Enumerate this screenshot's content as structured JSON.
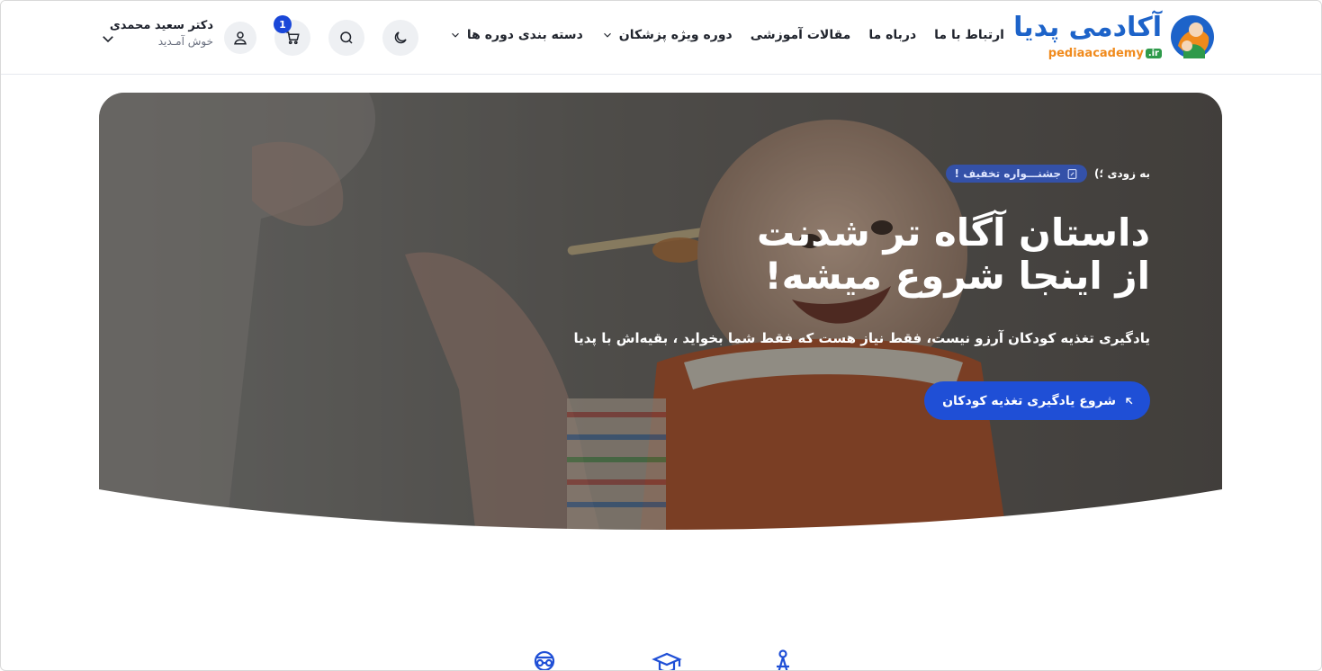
{
  "brand": {
    "name_fa": "آکادمی پدیا",
    "name_en": "pediaacademy",
    "tld": ".ir",
    "colors": {
      "blue": "#1d63c9",
      "orange": "#f08a1c",
      "green": "#2e9a4a"
    }
  },
  "nav": {
    "items": [
      {
        "label": "دسته بندی دوره ها",
        "has_dropdown": true
      },
      {
        "label": "دوره ویژه پزشکان",
        "has_dropdown": true
      },
      {
        "label": "مقالات آموزشی",
        "has_dropdown": false
      },
      {
        "label": "درباه ما",
        "has_dropdown": false
      },
      {
        "label": "ارتباط با ما",
        "has_dropdown": false
      }
    ]
  },
  "toolbar": {
    "theme_icon": "moon-icon",
    "search_icon": "search-icon",
    "cart_icon": "cart-icon",
    "cart_count": "1",
    "profile_icon": "user-icon"
  },
  "user": {
    "name": "دکتر سعید محمدی",
    "greeting": "خوش آمـدید"
  },
  "hero": {
    "badge": "جشنـــواره تخفیف !",
    "badge_suffix": "به زودی ؛)",
    "title_line1": "داستان آگاه تر شدنت",
    "title_line2": "از اینجا شروع میشه!",
    "subtitle": "یادگیری تغذیه کودکان آرزو نیست، فقط نیاز هست که فقط شما بخواید ، بقیه‌اش با پدیا",
    "cta_label": "شروع یادگیری تغذیه کودکان",
    "accent": "#1f4fd6"
  },
  "features": {
    "icons": [
      "doctor-icon",
      "graduation-cap-icon",
      "person-icon"
    ]
  }
}
